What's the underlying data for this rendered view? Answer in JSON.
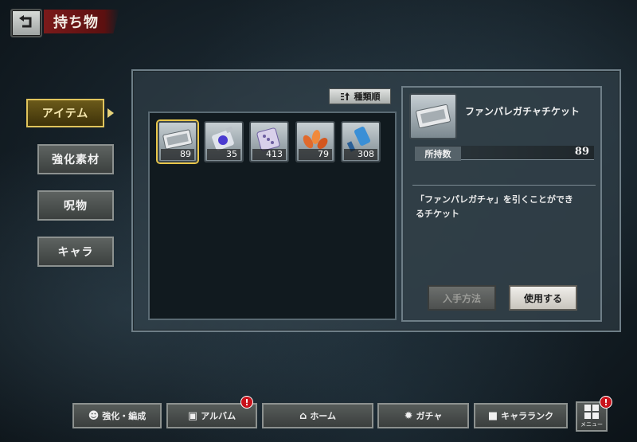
{
  "header": {
    "title": "持ち物"
  },
  "tabs": [
    {
      "label": "アイテム",
      "active": true
    },
    {
      "label": "強化素材",
      "active": false
    },
    {
      "label": "呪物",
      "active": false
    },
    {
      "label": "キャラ",
      "active": false
    }
  ],
  "sort": {
    "label": "種類順",
    "icon": "sort-icon"
  },
  "items": [
    {
      "icon": "ticket-icon",
      "count": "89",
      "selected": true
    },
    {
      "icon": "crystal-potion-icon",
      "count": "35"
    },
    {
      "icon": "dice-icon",
      "count": "413"
    },
    {
      "icon": "leaves-icon",
      "count": "79"
    },
    {
      "icon": "blue-hammer-icon",
      "count": "308"
    }
  ],
  "detail": {
    "name": "ファンパレガチャチケット",
    "count_label": "所持数",
    "count_value": "89",
    "description_line1": "「ファンパレガチャ」を引くことができ",
    "description_line2": "るチケット",
    "acquire_label": "入手方法",
    "use_label": "使用する"
  },
  "nav": [
    {
      "label": "強化・編成",
      "icon": "people-icon",
      "badge": ""
    },
    {
      "label": "アルバム",
      "icon": "album-icon",
      "badge": "!"
    },
    {
      "label": "ホーム",
      "icon": "home-icon",
      "badge": ""
    },
    {
      "label": "ガチャ",
      "icon": "gacha-icon",
      "badge": ""
    },
    {
      "label": "キャラランク",
      "icon": "character-icon",
      "badge": ""
    }
  ],
  "menu": {
    "label": "メニュー",
    "badge": "!"
  },
  "colors": {
    "accent_gold": "#e0c45c",
    "badge_red": "#c8121b"
  }
}
